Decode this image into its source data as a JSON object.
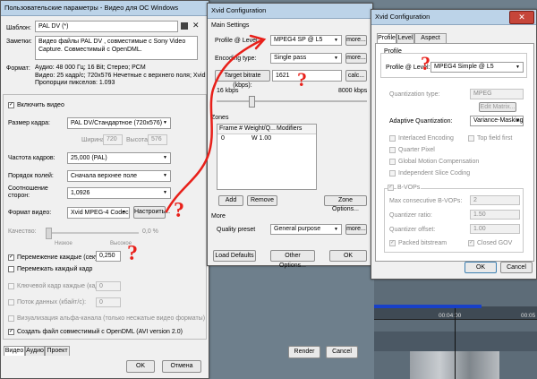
{
  "main": {
    "title": "Пользовательские параметры - Видео для ОС Windows",
    "template_label": "Шаблон:",
    "template_value": "PAL DV (*)",
    "notes_label": "Заметки:",
    "notes_value": "Видео файлы PAL DV , совместимые с Sony Video Capture. Совместимый с OpenDML.",
    "format_label": "Формат:",
    "format_value": "Аудио: 48 000 Гц; 16 Bit; Стерео; PCM\nВидео: 25 кадр/с; 720x576 Нечетные с верхнего поля; Xvid\nПропорции пикселов: 1.093",
    "include_video_label": "Включить видео",
    "frame_size_label": "Размер кадра:",
    "frame_size_value": "PAL DV/Стандартное (720x576)",
    "width_label": "Ширина:",
    "width_value": "720",
    "height_label": "Высота:",
    "height_value": "576",
    "framerate_label": "Частота кадров:",
    "framerate_value": "25,000 (PAL)",
    "field_order_label": "Порядок полей:",
    "field_order_value": "Сначала верхнее поле",
    "aspect_label": "Соотношение сторон:",
    "aspect_value": "1,0926",
    "video_format_label": "Формат видео:",
    "video_format_value": "Xvid MPEG-4 Codec",
    "configure_button": "Настроить...",
    "quality_label": "Качество:",
    "quality_low": "Низкое",
    "quality_high": "Высокое",
    "quality_percent": "0,0 %",
    "interleave_label": "Перемежение каждые (секунд):",
    "interleave_value": "0,250",
    "interleave_each_frame": "Перемежать каждый кадр",
    "keyframe_label": "Ключевой кадр каждые (кадров):",
    "keyframe_value": "0",
    "datarate_label": "Поток данных (кбайт/с):",
    "datarate_value": "0",
    "alpha_label": "Визуализация альфа-канала (только несжатые видео форматы)",
    "opendml_label": "Создать файл совместимый с OpenDML (AVI version 2.0)",
    "tabs": [
      "Видео",
      "Аудио",
      "Проект"
    ],
    "ok_button": "OK",
    "cancel_button": "Отмена"
  },
  "xvid1": {
    "title": "Xvid Configuration",
    "main_settings": "Main Settings",
    "profile_label": "Profile @ Level:",
    "profile_value": "MPEG4 SP @ L5",
    "more1": "more...",
    "encoding_label": "Encoding type:",
    "encoding_value": "Single pass",
    "more2": "more...",
    "target_bitrate_button": "Target bitrate (kbps):",
    "bitrate_value": "1621",
    "calc_button": "calc...",
    "slider_min": "16 kbps",
    "slider_max": "8000 kbps",
    "zones_label": "Zones",
    "zones_columns": [
      "Frame #",
      "Weight/Q...",
      "Modifiers"
    ],
    "zones_rows": [
      [
        "0",
        "W 1.00",
        ""
      ]
    ],
    "add_button": "Add",
    "remove_button": "Remove",
    "zone_options_button": "Zone Options...",
    "more_label": "More",
    "quality_preset_label": "Quality preset",
    "quality_preset_value": "General purpose",
    "more3": "more...",
    "load_defaults_button": "Load Defaults",
    "other_options_button": "Other Options...",
    "ok_button": "OK"
  },
  "xvid2": {
    "title": "Xvid Configuration",
    "tabs": [
      "Profile",
      "Level",
      "Aspect Ratio"
    ],
    "profile_group": "Profile",
    "profile_label": "Profile @ Level:",
    "profile_value": "MPEG4 Simple @ L5",
    "quant_type_label": "Quantization type:",
    "quant_type_value": "MPEG",
    "edit_matrix_button": "Edit Matrix...",
    "adaptive_quant_label": "Adaptive Quantization:",
    "adaptive_quant_value": "Variance-Masking",
    "interlaced": "Interlaced Encoding",
    "top_field_first": "Top field first",
    "quarter_pixel": "Quarter Pixel",
    "gmc": "Global Motion Compensation",
    "indep_slice": "Independent Slice Coding",
    "bvops_label": "B-VOPs",
    "max_bvops_label": "Max consecutive B-VOPs:",
    "max_bvops_value": "2",
    "quant_ratio_label": "Quantizer ratio:",
    "quant_ratio_value": "1.50",
    "quant_offset_label": "Quantizer offset:",
    "quant_offset_value": "1.00",
    "packed_bitstream": "Packed bitstream",
    "closed_gov": "Closed GOV",
    "ok_button": "OK",
    "cancel_button": "Cancel"
  },
  "background": {
    "render_button": "Render",
    "cancel_button": "Cancel",
    "timecode": "00:04:00",
    "timecode2": "00:05"
  },
  "annotations": {
    "question_mark": "?"
  }
}
